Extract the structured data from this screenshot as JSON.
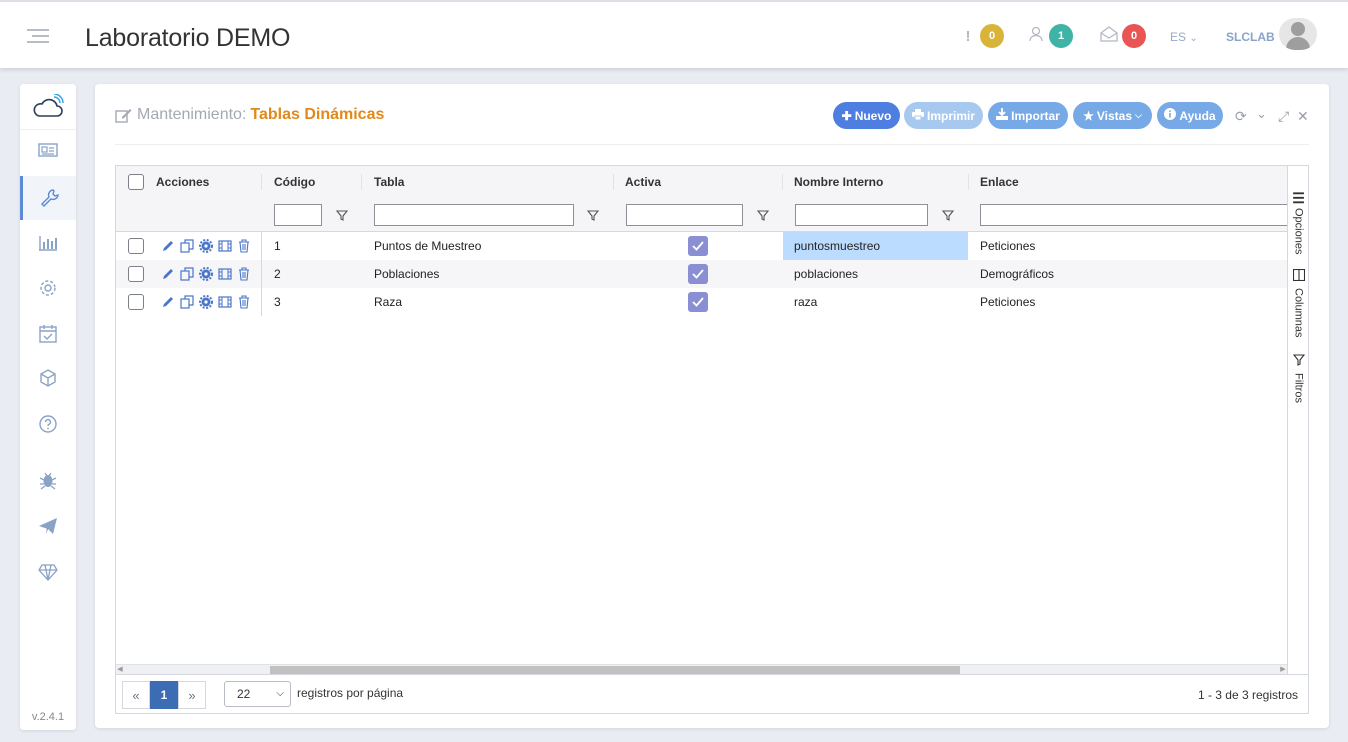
{
  "header": {
    "app_title": "Laboratorio DEMO",
    "alerts_count": "0",
    "users_count": "1",
    "messages_count": "0",
    "language": "ES",
    "username": "SLCLAB",
    "colors": {
      "alerts": "#d9b43a",
      "users": "#3fb3a5",
      "messages": "#e95454"
    }
  },
  "sidebar": {
    "items": [
      "cloud-logo",
      "news-icon",
      "wrench-icon",
      "bar-chart-icon",
      "gear-icon",
      "calendar-check-icon",
      "cube-icon",
      "help-icon",
      "bug-icon",
      "paper-plane-icon",
      "diamond-icon"
    ],
    "version": "v.2.4.1"
  },
  "panel": {
    "title_label": "Mantenimiento:",
    "title_value": "Tablas Dinámicas",
    "buttons": {
      "nuevo": "Nuevo",
      "imprimir": "Imprimir",
      "importar": "Importar",
      "vistas": "Vistas",
      "ayuda": "Ayuda"
    }
  },
  "grid": {
    "columns": {
      "acciones": "Acciones",
      "codigo": "Código",
      "tabla": "Tabla",
      "activa": "Activa",
      "nombre_interno": "Nombre Interno",
      "enlace": "Enlace"
    },
    "rows": [
      {
        "codigo": "1",
        "tabla": "Puntos de Muestreo",
        "activa": true,
        "nombre_interno": "puntosmuestreo",
        "enlace": "Peticiones"
      },
      {
        "codigo": "2",
        "tabla": "Poblaciones",
        "activa": true,
        "nombre_interno": "poblaciones",
        "enlace": "Demográficos"
      },
      {
        "codigo": "3",
        "tabla": "Raza",
        "activa": true,
        "nombre_interno": "raza",
        "enlace": "Peticiones"
      }
    ],
    "side_tabs": {
      "opciones": "Opciones",
      "columnas": "Columnas",
      "filtros": "Filtros"
    },
    "pager": {
      "current_page": "1",
      "page_size": "22",
      "page_size_label": "registros por página",
      "record_count": "1 - 3 de 3 registros"
    }
  }
}
